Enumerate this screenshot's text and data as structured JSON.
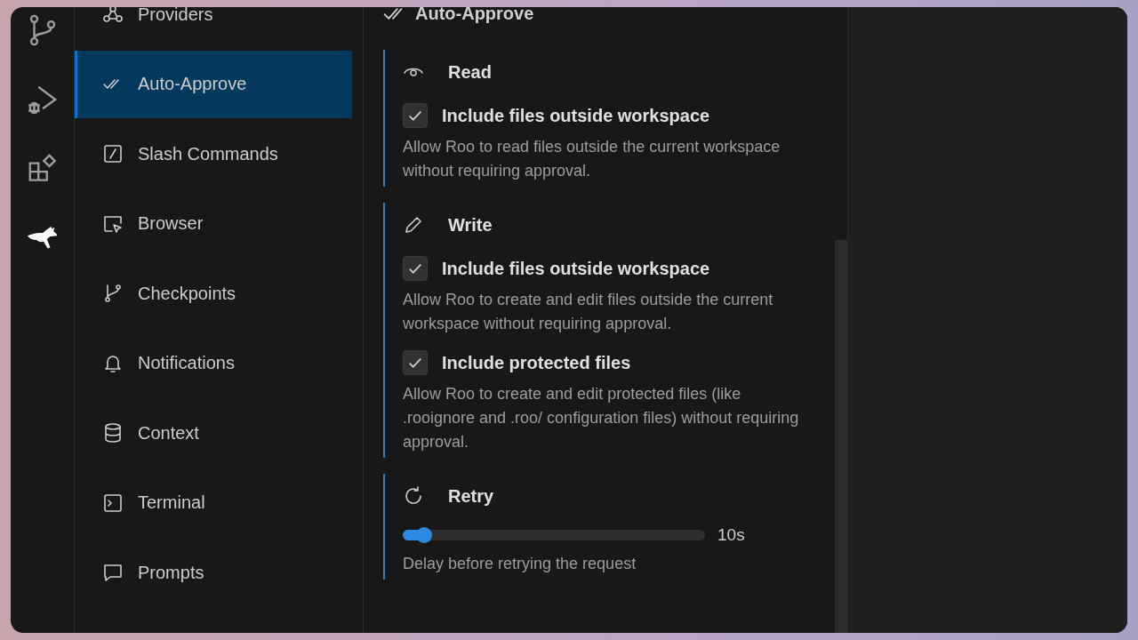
{
  "sidebar": {
    "items": [
      {
        "label": "Providers",
        "selected": false
      },
      {
        "label": "Auto-Approve",
        "selected": true
      },
      {
        "label": "Slash Commands",
        "selected": false
      },
      {
        "label": "Browser",
        "selected": false
      },
      {
        "label": "Checkpoints",
        "selected": false
      },
      {
        "label": "Notifications",
        "selected": false
      },
      {
        "label": "Context",
        "selected": false
      },
      {
        "label": "Terminal",
        "selected": false
      },
      {
        "label": "Prompts",
        "selected": false
      }
    ]
  },
  "content": {
    "header": "Auto-Approve",
    "sections": [
      {
        "kind": "checks",
        "title": "Read",
        "options": [
          {
            "label": "Include files outside workspace",
            "checked": true,
            "description": "Allow Roo to read files outside the current workspace without requiring approval."
          }
        ]
      },
      {
        "kind": "checks",
        "title": "Write",
        "options": [
          {
            "label": "Include files outside workspace",
            "checked": true,
            "description": "Allow Roo to create and edit files outside the current workspace without requiring approval."
          },
          {
            "label": "Include protected files",
            "checked": true,
            "description": "Allow Roo to create and edit protected files (like .rooignore and .roo/ configuration files) without requiring approval."
          }
        ]
      },
      {
        "kind": "slider",
        "title": "Retry",
        "level": 0.07,
        "reading": "10s",
        "description": "Delay before retrying the request"
      }
    ]
  }
}
